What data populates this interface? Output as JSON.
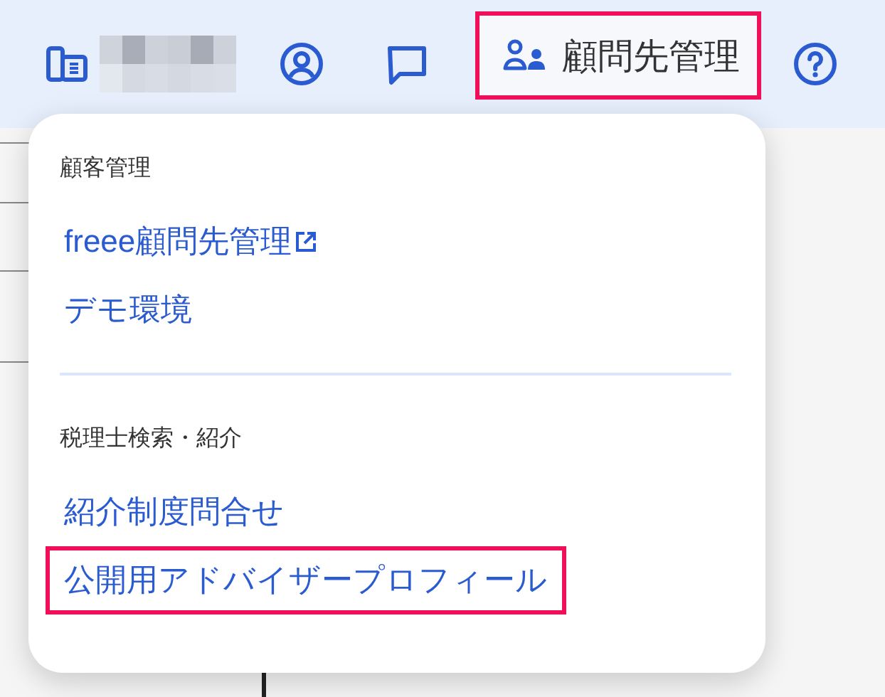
{
  "toolbar": [
    {
      "kind": "office"
    },
    {
      "kind": "account"
    },
    {
      "kind": "chat"
    },
    {
      "kind": "clients",
      "label": "顧問先管理",
      "highlighted": true
    },
    {
      "kind": "help"
    }
  ],
  "menu": {
    "sections": [
      {
        "heading": "顧客管理",
        "items": [
          {
            "label": "freee顧問先管理",
            "external": true,
            "highlighted": false
          },
          {
            "label": "デモ環境",
            "external": false,
            "highlighted": false
          }
        ]
      },
      {
        "heading": "税理士検索・紹介",
        "items": [
          {
            "label": "紹介制度問合せ",
            "external": false,
            "highlighted": false
          },
          {
            "label": "公開用アドバイザープロフィール",
            "external": false,
            "highlighted": true
          }
        ]
      }
    ]
  }
}
